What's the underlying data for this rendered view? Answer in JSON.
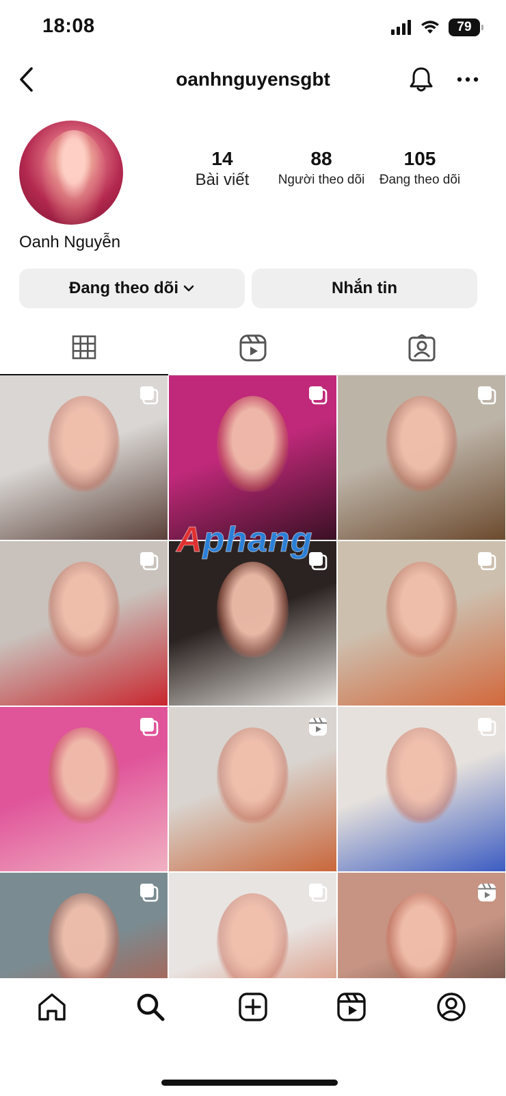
{
  "status_bar": {
    "time": "18:08",
    "battery": "79"
  },
  "header": {
    "username": "oanhnguyensgbt"
  },
  "profile": {
    "display_name": "Oanh Nguyễn",
    "stats": [
      {
        "value": "14",
        "label": "Bài viết"
      },
      {
        "value": "88",
        "label": "Người theo dõi"
      },
      {
        "value": "105",
        "label": "Đang theo dõi"
      }
    ]
  },
  "actions": {
    "following_label": "Đang theo dõi",
    "message_label": "Nhắn tin"
  },
  "tabs": [
    {
      "icon": "grid-icon",
      "active": true
    },
    {
      "icon": "reels-icon",
      "active": false
    },
    {
      "icon": "tagged-icon",
      "active": false
    }
  ],
  "watermark": {
    "first": "A",
    "rest": "phang"
  },
  "grid_posts": [
    {
      "kind": "carousel",
      "palette": [
        "#d9d6d3",
        "#5a4038"
      ]
    },
    {
      "kind": "carousel",
      "palette": [
        "#c0297a",
        "#3a1024"
      ]
    },
    {
      "kind": "carousel",
      "palette": [
        "#bdb4a8",
        "#6c4a2e"
      ]
    },
    {
      "kind": "carousel",
      "palette": [
        "#c9c2bc",
        "#c8262e"
      ]
    },
    {
      "kind": "carousel",
      "palette": [
        "#2b2321",
        "#e8e4df"
      ]
    },
    {
      "kind": "carousel",
      "palette": [
        "#cdbfae",
        "#d2683c"
      ]
    },
    {
      "kind": "carousel",
      "palette": [
        "#e0559a",
        "#f1b2c2"
      ]
    },
    {
      "kind": "reel",
      "palette": [
        "#d9d4cf",
        "#c9663a"
      ]
    },
    {
      "kind": "carousel",
      "palette": [
        "#e6e1dc",
        "#3c5cc2"
      ]
    },
    {
      "kind": "carousel",
      "palette": [
        "#7a8c92",
        "#c84a2e"
      ]
    },
    {
      "kind": "carousel",
      "palette": [
        "#e8e4e2",
        "#d26a48"
      ]
    },
    {
      "kind": "reel",
      "palette": [
        "#c79483",
        "#3a2620"
      ]
    }
  ],
  "bottom_nav": [
    "home-icon",
    "search-icon",
    "create-icon",
    "reels-icon",
    "profile-icon"
  ]
}
